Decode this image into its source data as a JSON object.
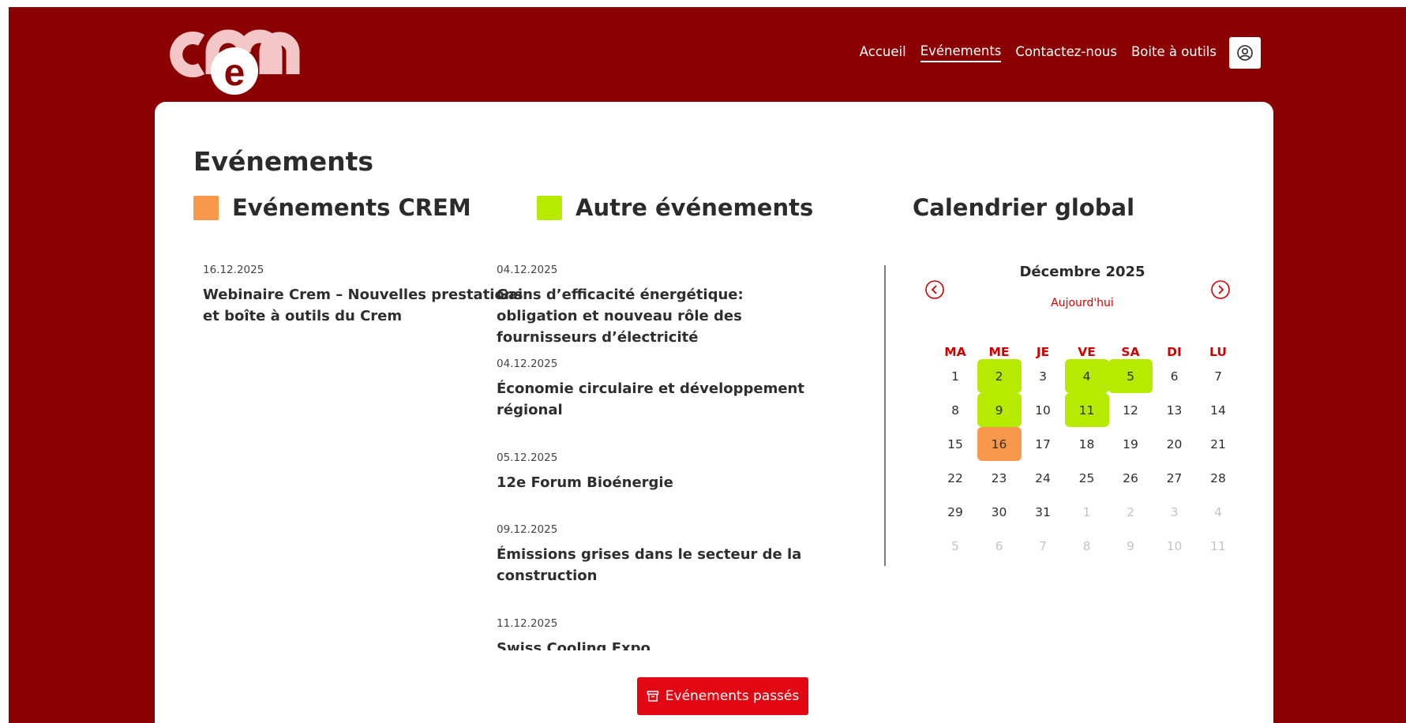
{
  "brand": {
    "logo_text": "crem",
    "background": "#8b0000",
    "accent_red": "#e30613",
    "crem_color": "#f7984a",
    "other_color": "#b6ea00"
  },
  "nav": {
    "items": [
      {
        "label": "Accueil"
      },
      {
        "label": "Evénements"
      },
      {
        "label": "Contactez-nous"
      },
      {
        "label": "Boite à outils"
      }
    ],
    "active": "Evénements",
    "account_icon": "user-circle-icon"
  },
  "page": {
    "title": "Evénements"
  },
  "crem_events": {
    "heading": "Evénements CREM",
    "items": [
      {
        "date": "16.12.2025",
        "title": "Webinaire Crem – Nouvelles prestations et boîte à outils du Crem"
      }
    ]
  },
  "other_events": {
    "heading": "Autre événements",
    "items": [
      {
        "date": "04.12.2025",
        "title": "Gains d’efficacité énergétique: obligation et nouveau rôle des fournisseurs d’électricité"
      },
      {
        "date": "04.12.2025",
        "title": "Économie circulaire et développement régional"
      },
      {
        "date": "05.12.2025",
        "title": "12e Forum Bioénergie"
      },
      {
        "date": "09.12.2025",
        "title": "Émissions grises dans le secteur de la construction"
      },
      {
        "date": "11.12.2025",
        "title": "Swiss Cooling Expo"
      }
    ]
  },
  "calendar": {
    "heading": "Calendrier global",
    "month": "Décembre 2025",
    "today_label": "Aujourd'hui",
    "prev_icon": "chevron-left-circle-icon",
    "next_icon": "chevron-right-circle-icon",
    "weekdays": [
      "MA",
      "ME",
      "JE",
      "VE",
      "SA",
      "DI",
      "LU"
    ],
    "weeks": [
      [
        {
          "d": "1",
          "t": ""
        },
        {
          "d": "2",
          "t": "other"
        },
        {
          "d": "3",
          "t": ""
        },
        {
          "d": "4",
          "t": "other"
        },
        {
          "d": "5",
          "t": "other"
        },
        {
          "d": "6",
          "t": ""
        },
        {
          "d": "7",
          "t": ""
        }
      ],
      [
        {
          "d": "8",
          "t": ""
        },
        {
          "d": "9",
          "t": "other"
        },
        {
          "d": "10",
          "t": ""
        },
        {
          "d": "11",
          "t": "other"
        },
        {
          "d": "12",
          "t": ""
        },
        {
          "d": "13",
          "t": ""
        },
        {
          "d": "14",
          "t": ""
        }
      ],
      [
        {
          "d": "15",
          "t": ""
        },
        {
          "d": "16",
          "t": "crem"
        },
        {
          "d": "17",
          "t": ""
        },
        {
          "d": "18",
          "t": ""
        },
        {
          "d": "19",
          "t": ""
        },
        {
          "d": "20",
          "t": ""
        },
        {
          "d": "21",
          "t": ""
        }
      ],
      [
        {
          "d": "22",
          "t": ""
        },
        {
          "d": "23",
          "t": ""
        },
        {
          "d": "24",
          "t": ""
        },
        {
          "d": "25",
          "t": ""
        },
        {
          "d": "26",
          "t": ""
        },
        {
          "d": "27",
          "t": ""
        },
        {
          "d": "28",
          "t": ""
        }
      ],
      [
        {
          "d": "29",
          "t": ""
        },
        {
          "d": "30",
          "t": ""
        },
        {
          "d": "31",
          "t": ""
        },
        {
          "d": "1",
          "t": "muted"
        },
        {
          "d": "2",
          "t": "muted"
        },
        {
          "d": "3",
          "t": "muted"
        },
        {
          "d": "4",
          "t": "muted"
        }
      ],
      [
        {
          "d": "5",
          "t": "muted"
        },
        {
          "d": "6",
          "t": "muted"
        },
        {
          "d": "7",
          "t": "muted"
        },
        {
          "d": "8",
          "t": "muted"
        },
        {
          "d": "9",
          "t": "muted"
        },
        {
          "d": "10",
          "t": "muted"
        },
        {
          "d": "11",
          "t": "muted"
        }
      ]
    ]
  },
  "past_button": {
    "label": "Evénements passés",
    "icon": "archive-icon"
  }
}
